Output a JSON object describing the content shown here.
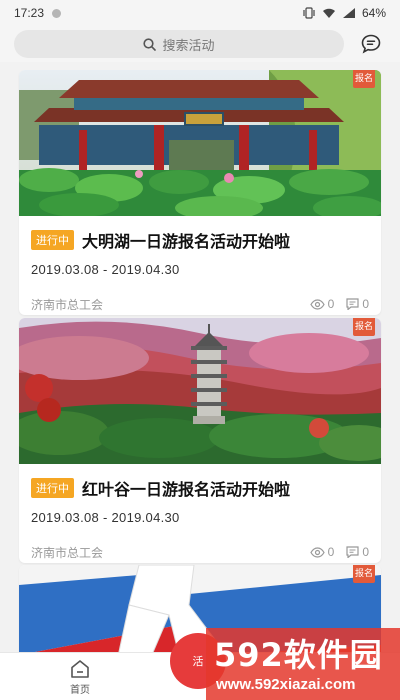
{
  "status_bar": {
    "time": "17:23",
    "battery": "64%"
  },
  "search": {
    "placeholder": "搜索活动"
  },
  "activities": [
    {
      "signup_badge": "报名",
      "status": "进行中",
      "title": "大明湖一日游报名活动开始啦",
      "date_range": "2019.03.08 - 2019.04.30",
      "organizer": "济南市总工会",
      "views": "0",
      "comments": "0"
    },
    {
      "signup_badge": "报名",
      "status": "进行中",
      "title": "红叶谷一日游报名活动开始啦",
      "date_range": "2019.03.08 - 2019.04.30",
      "organizer": "济南市总工会",
      "views": "0",
      "comments": "0"
    },
    {
      "signup_badge": "报名"
    }
  ],
  "tab_bar": {
    "home_label": "首页",
    "center_label": "活"
  },
  "watermark": {
    "brand": "592软件园",
    "url": "www.592xiazai.com"
  },
  "colors": {
    "accent_orange": "#f5a623",
    "badge_red": "#e25a3a",
    "fab_red": "#e63b3b"
  }
}
